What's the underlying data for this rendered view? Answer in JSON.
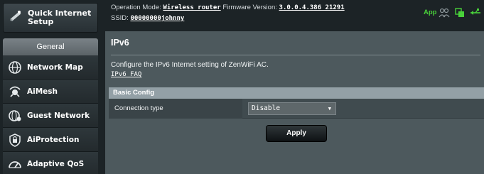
{
  "sidebar": {
    "quick_setup": {
      "label_line1": "Quick Internet",
      "label_line2": "Setup",
      "icon": "wand-icon"
    },
    "section_title": "General",
    "items": [
      {
        "label": "Network Map",
        "icon": "globe-icon"
      },
      {
        "label": "AiMesh",
        "icon": "mesh-icon"
      },
      {
        "label": "Guest Network",
        "icon": "guest-globe-icon"
      },
      {
        "label": "AiProtection",
        "icon": "lock-icon"
      },
      {
        "label": "Adaptive QoS",
        "icon": "speedometer-icon"
      }
    ]
  },
  "topbar": {
    "operation_mode_label": "Operation Mode:",
    "operation_mode_value": "Wireless router",
    "firmware_label": "Firmware Version:",
    "firmware_value": "3.0.0.4.386_21291",
    "ssid_label": "SSID:",
    "ssid_value": "00000000johnny",
    "app_label": "App",
    "status_icons": [
      "users-icon",
      "copy-icon",
      "usb-icon"
    ]
  },
  "main": {
    "title": "IPv6",
    "description": "Configure the IPv6 Internet setting of ZenWiFi AC.",
    "faq_link": "IPv6 FAQ",
    "section_header": "Basic Config",
    "connection_type_label": "Connection type",
    "connection_type_value": "Disable",
    "apply_label": "Apply"
  },
  "colors": {
    "background": "#1c2326",
    "panel": "#4d595d",
    "section_header": "#93a0a6",
    "app_accent": "#49d13a"
  }
}
